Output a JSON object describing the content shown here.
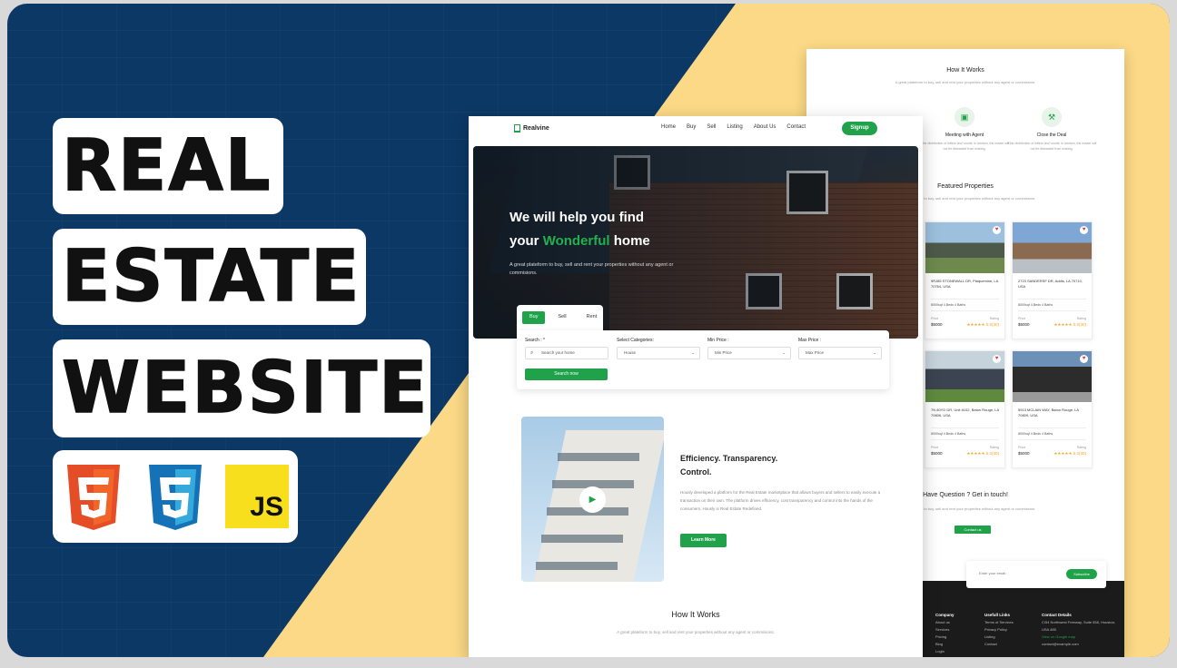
{
  "thumbnail": {
    "title_lines": [
      "REAL",
      "ESTATE",
      "WEBSITE"
    ],
    "tech_icons": [
      "html5-icon",
      "css3-icon",
      "js-icon"
    ],
    "js_label": "JS",
    "colors": {
      "navy": "#0c3866",
      "yellow": "#fbd986",
      "green": "#1fa24a"
    }
  },
  "site": {
    "brand": "Realvine",
    "nav": [
      "Home",
      "Buy",
      "Sell",
      "Listing",
      "About Us",
      "Contact"
    ],
    "signup": "Signup",
    "hero": {
      "line1": "We will help you find",
      "line2_pre": "your",
      "line2_highlight": "Wonderful",
      "line2_post": "home",
      "desc": "A great plateform to buy, sell and rent your properties without any agent or commisions."
    },
    "search": {
      "tabs": [
        "Buy",
        "Sell",
        "Rent"
      ],
      "fields": [
        {
          "label": "Search : *",
          "value": "Search your home"
        },
        {
          "label": "Select Categories:",
          "value": "House"
        },
        {
          "label": "Min Price :",
          "value": "Min Price"
        },
        {
          "label": "Max Price :",
          "value": "Max Price"
        }
      ],
      "button": "Search now"
    },
    "about": {
      "title": "Efficiency. Transparency. Control.",
      "desc": "Hously developed a platform for the Real Estate marketplace that allows buyers and sellers to easily execute a transaction on their own. The platform drives efficiency, cost transparency and control into the hands of the consumers. Hously is Real Estate Redefined.",
      "button": "Learn More"
    },
    "how": {
      "title": "How It Works",
      "desc": "A great plateform to buy, sell and rent your properties without any agent or commisions."
    }
  },
  "back": {
    "how_title": "How It Works",
    "how_desc": "A great plateform to buy, sell and rent your properties without any agent or commisions.",
    "steps": [
      {
        "title": "Meeting with Agent",
        "desc": "If the distribution of letters and 'words' is random, the reader will not be distracted from making."
      },
      {
        "title": "Close the Deal",
        "desc": "If the distribution of letters and 'words' is random, the reader will not be distracted from making."
      }
    ],
    "featured_title": "Featured Properties",
    "featured_desc": "A great plateform to buy, sell and rent your properties without any agent or commisions.",
    "properties": [
      {
        "address": "9RJ85 STONEWALL DR, Plaquemine, LA 70764, USA",
        "features": "8000sqf  4 Beds  4 Baths",
        "price_label": "Price",
        "rating_label": "Rating",
        "price": "$5000",
        "rating": "★★★★★ 5.0(30)"
      },
      {
        "address": "2723 SANDERSF DR, Addis, LA 70710, USA",
        "features": "8000sqf  4 Beds  4 Baths",
        "price_label": "Price",
        "rating_label": "Rating",
        "price": "$5000",
        "rating": "★★★★★ 5.0(30)"
      },
      {
        "address": "7N 80YD DR, Unit #102, Baton Rouge, LA 70806, USA",
        "features": "8000sqf  4 Beds  4 Baths",
        "price_label": "Price",
        "rating_label": "Rating",
        "price": "$5000",
        "rating": "★★★★★ 5.0(30)"
      },
      {
        "address": "5913 MCLAIN WAY, Baton Rouge, LA 70809, USA",
        "features": "8000sqf  4 Beds  4 Baths",
        "price_label": "Price",
        "rating_label": "Rating",
        "price": "$5000",
        "rating": "★★★★★ 5.0(30)"
      }
    ],
    "question_title": "Have Question ? Get in touch!",
    "question_desc": "A great plateform to buy, sell and rent your properties without any agent or commisions.",
    "contact_button": "Contact us",
    "email_placeholder": "Enter your email :",
    "subscribe": "Subscribe",
    "footer": {
      "company": {
        "title": "Company",
        "items": [
          "About us",
          "Services",
          "Pricing",
          "Blog",
          "Login"
        ]
      },
      "useful": {
        "title": "Usefull Links",
        "items": [
          "Terms of Services",
          "Privacy Policy",
          "Listing",
          "Contact"
        ]
      },
      "contact": {
        "title": "Contact Details",
        "address": "C/54 Northwest Freeway, Suite 558, Houston, USA 485",
        "map_link": "View on Google map",
        "email": "contact@example.com"
      }
    }
  }
}
